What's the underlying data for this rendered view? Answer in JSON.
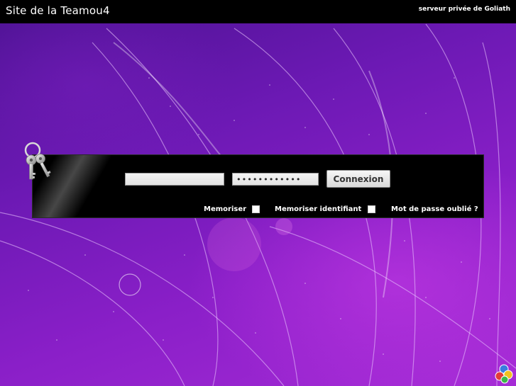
{
  "header": {
    "site_title": "Site de la Teamou4",
    "server_label": "serveur privée de Goliath"
  },
  "login": {
    "username_value": "",
    "password_value": "••••••••••••",
    "connect_label": "Connexion",
    "remember_label": "Memoriser",
    "remember_checked": false,
    "remember_id_label": "Memoriser identifiant",
    "remember_id_checked": false,
    "forgot_label": "Mot de passe oublié ?"
  },
  "icons": {
    "keys": "keys-icon",
    "corner": "colored-balls-icon"
  },
  "colors": {
    "background": "#7a1cc0",
    "panel": "#000000",
    "topbar": "#000000"
  }
}
